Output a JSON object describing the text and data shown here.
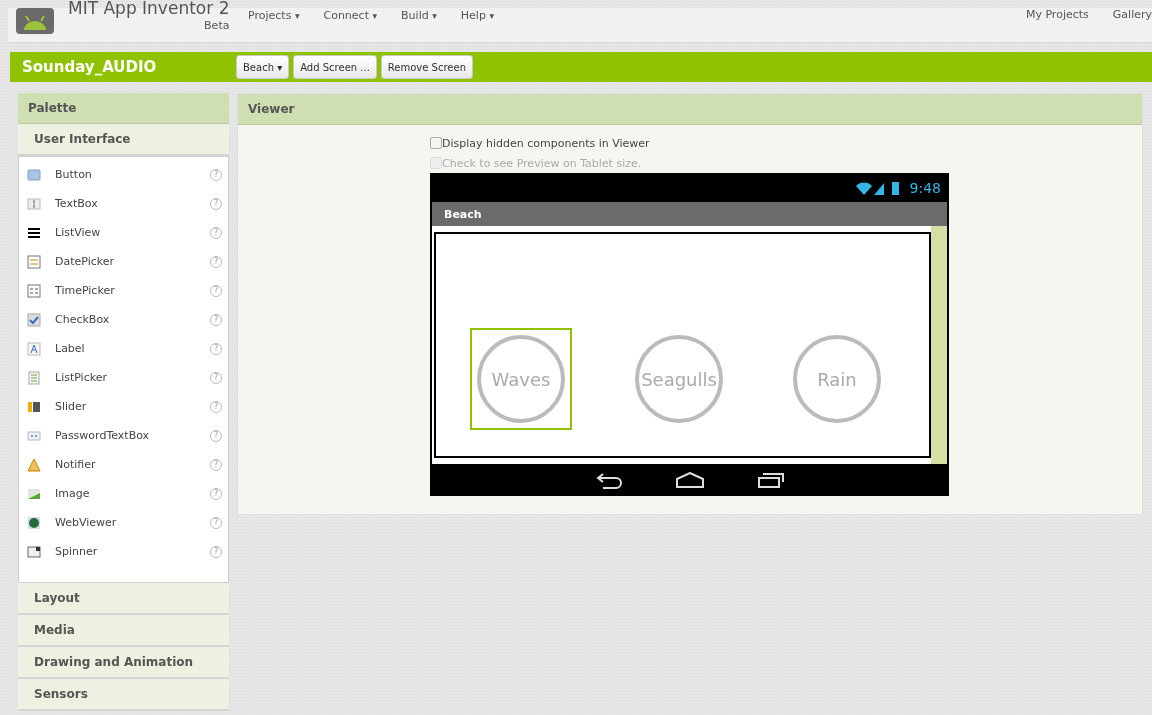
{
  "header": {
    "title": "MIT App Inventor 2",
    "subtitle": "Beta",
    "menus": [
      {
        "label": "Projects",
        "caret": "▾"
      },
      {
        "label": "Connect",
        "caret": "▾"
      },
      {
        "label": "Build",
        "caret": "▾"
      },
      {
        "label": "Help",
        "caret": "▾"
      }
    ],
    "links": [
      "My Projects",
      "Gallery"
    ]
  },
  "project_bar": {
    "name": "Sounday_AUDIO",
    "buttons": [
      {
        "label": "Beach",
        "caret": "▾"
      },
      {
        "label": "Add Screen ..."
      },
      {
        "label": "Remove Screen"
      }
    ]
  },
  "palette": {
    "title": "Palette",
    "open_section": "User Interface",
    "items": [
      {
        "label": "Button",
        "kind": "button",
        "help": "?"
      },
      {
        "label": "TextBox",
        "kind": "textbox",
        "help": "?"
      },
      {
        "label": "ListView",
        "kind": "listview",
        "help": "?"
      },
      {
        "label": "DatePicker",
        "kind": "datepicker",
        "help": "?"
      },
      {
        "label": "TimePicker",
        "kind": "timepicker",
        "help": "?"
      },
      {
        "label": "CheckBox",
        "kind": "checkbox",
        "help": "?"
      },
      {
        "label": "Label",
        "kind": "label",
        "help": "?"
      },
      {
        "label": "ListPicker",
        "kind": "listpicker",
        "help": "?"
      },
      {
        "label": "Slider",
        "kind": "slider",
        "help": "?"
      },
      {
        "label": "PasswordTextBox",
        "kind": "password",
        "help": "?"
      },
      {
        "label": "Notifier",
        "kind": "notifier",
        "help": "?"
      },
      {
        "label": "Image",
        "kind": "image",
        "help": "?"
      },
      {
        "label": "WebViewer",
        "kind": "webviewer",
        "help": "?"
      },
      {
        "label": "Spinner",
        "kind": "spinner",
        "help": "?"
      }
    ],
    "sections": [
      "Layout",
      "Media",
      "Drawing and Animation",
      "Sensors"
    ]
  },
  "viewer": {
    "title": "Viewer",
    "options": [
      {
        "label": "Display hidden components in Viewer",
        "checked": false,
        "disabled": false
      },
      {
        "label": "Check to see Preview on Tablet size.",
        "checked": false,
        "disabled": true
      }
    ],
    "phone": {
      "time": "9:48",
      "screen_title": "Beach",
      "buttons": [
        {
          "label": "Waves",
          "selected": true
        },
        {
          "label": "Seagulls",
          "selected": false
        },
        {
          "label": "Rain",
          "selected": false
        }
      ]
    }
  }
}
